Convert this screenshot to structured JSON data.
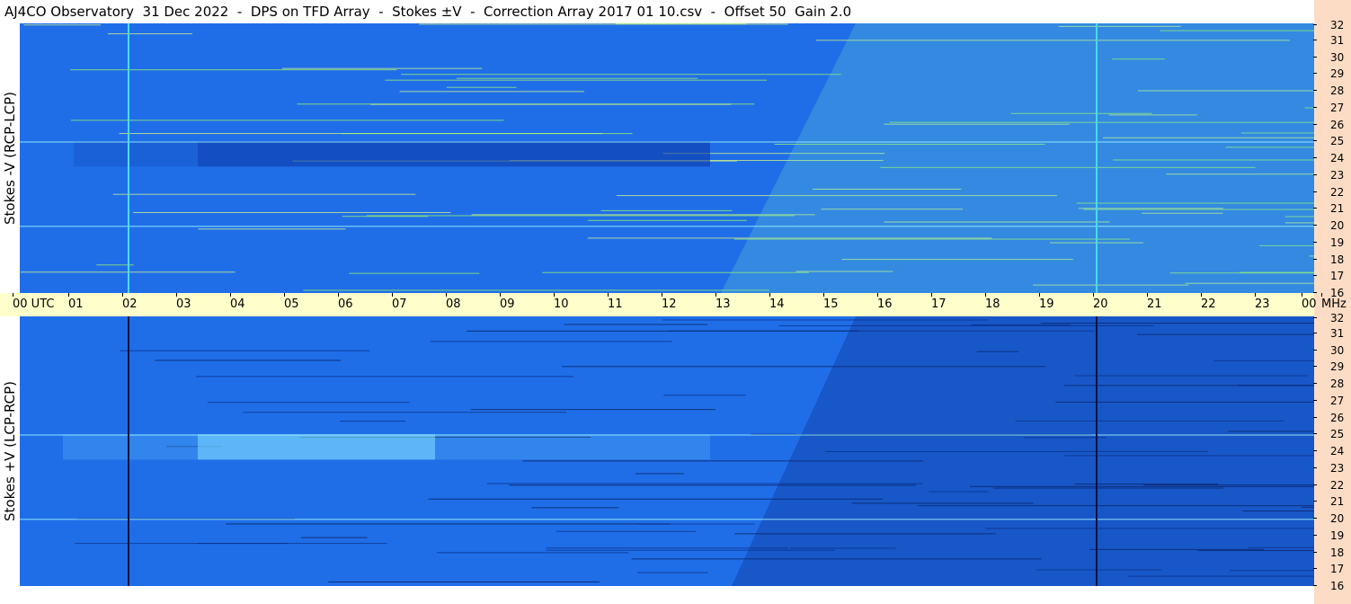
{
  "title": "AJ4CO Observatory  31 Dec 2022  -  DPS on TFD Array  -  Stokes ±V  -  Correction Array 2017 01 10.csv  -  Offset 50  Gain 2.0",
  "colors": {
    "background_blue": "#1f6ee8",
    "dark_band": "#0c3aa8",
    "bright_band": "#7fe0ff",
    "time_axis_bg": "#ffffcc",
    "freq_axis_bg": "#fcdcc4"
  },
  "chart_data": [
    {
      "type": "heatmap",
      "ylabel": "Stokes -V (RCP-LCP)",
      "yunit": "MHz",
      "ylim": [
        16,
        32
      ],
      "yticks": [
        "32",
        "31",
        "30",
        "29",
        "28",
        "27",
        "26",
        "25",
        "24",
        "23",
        "22",
        "21",
        "20",
        "19",
        "18",
        "17",
        "16"
      ],
      "xlim_utc": [
        0,
        24
      ],
      "dark_region_utc": [
        3.3,
        12.8
      ],
      "dark_band_mhz": [
        23.5,
        25
      ],
      "bright_region_utc": [
        13,
        24
      ],
      "vertical_lines_utc": [
        2.0,
        19.95
      ]
    },
    {
      "type": "heatmap",
      "ylabel": "Stokes +V (LCP-RCP)",
      "yunit": "MHz",
      "ylim": [
        16,
        32
      ],
      "yticks": [
        "32",
        "31",
        "30",
        "29",
        "28",
        "27",
        "26",
        "25",
        "24",
        "23",
        "22",
        "21",
        "20",
        "19",
        "18",
        "17",
        "16"
      ],
      "xlim_utc": [
        0,
        24
      ],
      "bright_region_utc": [
        3.3,
        7.7
      ],
      "bright_band_mhz": [
        23.5,
        25
      ],
      "dark_region_utc": [
        13,
        24
      ],
      "vertical_lines_utc": [
        2.0,
        19.95
      ]
    }
  ],
  "time_axis": {
    "labels": [
      "00  UTC",
      "01",
      "02",
      "03",
      "04",
      "05",
      "06",
      "07",
      "08",
      "09",
      "10",
      "11",
      "12",
      "13",
      "14",
      "15",
      "16",
      "17",
      "18",
      "19",
      "20",
      "21",
      "22",
      "23",
      "00"
    ],
    "unit_label": "MHz"
  }
}
